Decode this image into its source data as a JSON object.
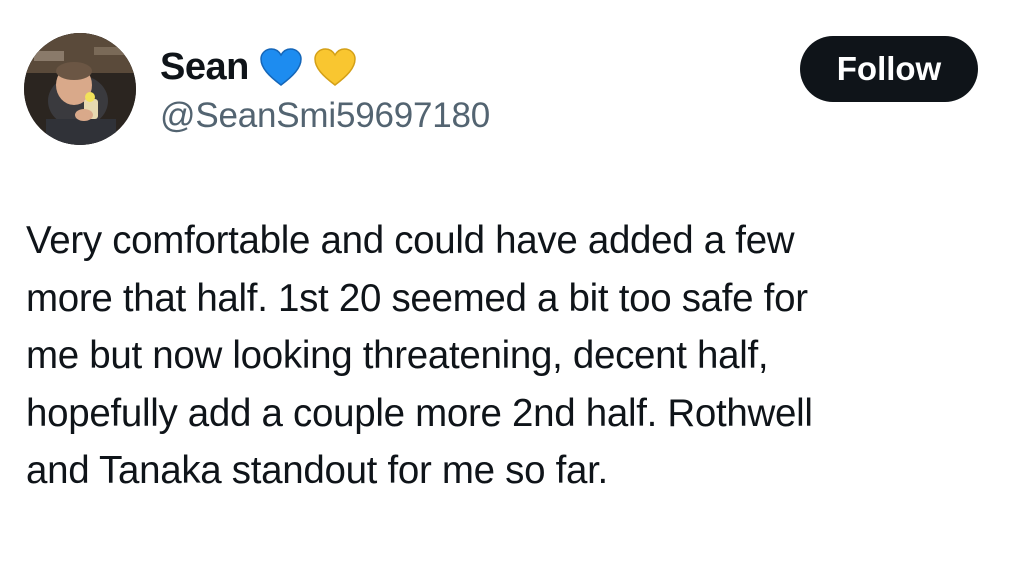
{
  "user": {
    "display_name": "Sean",
    "handle": "@SeanSmi59697180",
    "badges": [
      "blue-heart-icon",
      "yellow-heart-icon"
    ],
    "badge_colors": [
      "#1d8cf0",
      "#f9c630"
    ]
  },
  "actions": {
    "follow_label": "Follow"
  },
  "tweet": {
    "lines": [
      "Very comfortable and could have added a few",
      "more that half. 1st 20 seemed a bit too safe for",
      "me but now looking threatening, decent half,",
      "hopefully add a couple more 2nd half. Rothwell",
      "and Tanaka standout for me so far."
    ]
  }
}
